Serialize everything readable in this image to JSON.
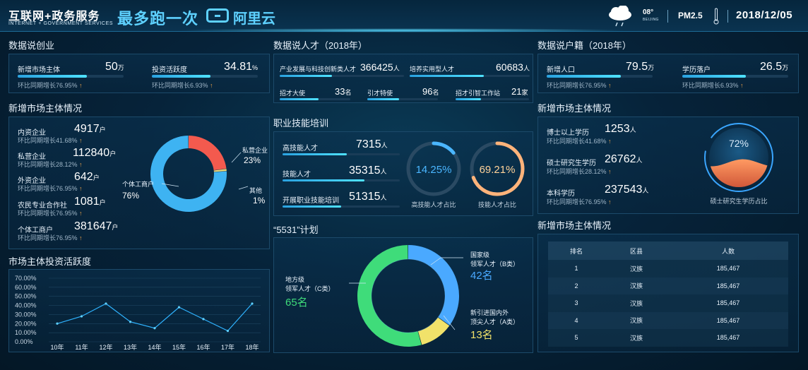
{
  "header": {
    "brand_cn": "互联网+政务服务",
    "brand_en": "INTERNET + GOVERNMENT SERVICES",
    "slogan": "最多跑一次",
    "slogan_brand": "阿里云",
    "temperature": "08°",
    "city": "BEIJING",
    "pm": "PM2.5",
    "date": "2018/12/05"
  },
  "startup": {
    "title": "数据说创业",
    "items": [
      {
        "label": "新增市场主体",
        "value": "50",
        "unit": "万",
        "growth": "环比同期增长76.95%",
        "progress": 0.65
      },
      {
        "label": "投资活跃度",
        "value": "34.81",
        "unit": "%",
        "growth": "环比同期增长6.93%",
        "progress": 0.55
      }
    ]
  },
  "market_left": {
    "title": "新增市场主体情况",
    "items": [
      {
        "label": "内资企业",
        "value": "4917",
        "unit": "户",
        "growth": "环比同期增长41.68%"
      },
      {
        "label": "私营企业",
        "value": "112840",
        "unit": "户",
        "growth": "环比同期增长28.12%"
      },
      {
        "label": "外资企业",
        "value": "642",
        "unit": "户",
        "growth": "环比同期增长76.95%"
      },
      {
        "label": "农民专业合作社",
        "value": "1081",
        "unit": "户",
        "growth": "环比同期增长76.95%"
      },
      {
        "label": "个体工商户",
        "value": "381647",
        "unit": "户",
        "growth": "环比同期增长76.95%"
      }
    ],
    "donut": [
      {
        "name": "私营企业",
        "pct": "23%",
        "value": 23,
        "color": "#f35a4e"
      },
      {
        "name": "其他",
        "pct": "1%",
        "value": 1,
        "color": "#e9d77a"
      },
      {
        "name": "个体工商户",
        "pct": "76%",
        "value": 76,
        "color": "#3eb3f2"
      }
    ]
  },
  "activity": {
    "title": "市场主体投资活跃度",
    "chart_data": {
      "type": "line",
      "x": [
        "10年",
        "11年",
        "12年",
        "13年",
        "14年",
        "15年",
        "16年",
        "17年",
        "18年"
      ],
      "values": [
        20,
        28,
        42,
        22,
        15,
        38,
        25,
        12,
        42
      ],
      "yticks": [
        "70.00%",
        "60.00%",
        "50.00%",
        "40.00%",
        "30.00%",
        "20.00%",
        "10.00%",
        "0.00%"
      ],
      "ylim": [
        0,
        70
      ]
    }
  },
  "talent": {
    "title": "数据说人才（2018年）",
    "row1": [
      {
        "label": "产业发展与科技创新类人才",
        "value": "366425",
        "unit": "人",
        "progress": 0.42
      },
      {
        "label": "培养实用型人才",
        "value": "60683",
        "unit": "人",
        "progress": 0.62
      }
    ],
    "row2": [
      {
        "label": "招才大使",
        "value": "33",
        "unit": "名",
        "progress": 0.55
      },
      {
        "label": "引才特使",
        "value": "96",
        "unit": "名",
        "progress": 0.45
      },
      {
        "label": "招才引智工作站",
        "value": "21",
        "unit": "家",
        "progress": 0.35
      }
    ]
  },
  "skills": {
    "title": "职业技能培训",
    "items": [
      {
        "label": "高技能人才",
        "value": "7315",
        "unit": "人",
        "progress": 0.55
      },
      {
        "label": "技能人才",
        "value": "35315",
        "unit": "人",
        "progress": 0.7
      },
      {
        "label": "开展职业技能培训",
        "value": "51315",
        "unit": "人",
        "progress": 0.5
      }
    ],
    "gauges": [
      {
        "value": "14.25%",
        "label": "高技能人才占比",
        "fraction": 0.1425,
        "color": "#4ab6ff"
      },
      {
        "value": "69.21%",
        "label": "技能人才占比",
        "fraction": 0.6921,
        "color": "#ffb37a"
      }
    ]
  },
  "plan": {
    "title": "“5531”计划",
    "segments": [
      {
        "line1": "国家级",
        "line2": "领军人才（B类）",
        "count": "42名",
        "value": 42,
        "color": "#4aa9ff"
      },
      {
        "line1": "新引进国内外",
        "line2": "顶尖人才（A类）",
        "count": "13名",
        "value": 13,
        "color": "#f1e26a"
      },
      {
        "line1": "地方级",
        "line2": "领军人才（C类）",
        "count": "65名",
        "value": 65,
        "color": "#3fdc7a"
      }
    ]
  },
  "household": {
    "title": "数据说户籍（2018年）",
    "items": [
      {
        "label": "新增人口",
        "value": "79.5",
        "unit": "万",
        "growth": "环比同期增长76.95%",
        "progress": 0.7
      },
      {
        "label": "学历落户",
        "value": "26.5",
        "unit": "万",
        "growth": "环比同期增长6.93%",
        "progress": 0.6
      }
    ]
  },
  "market_right": {
    "title": "新增市场主体情况",
    "items": [
      {
        "label": "博士以上学历",
        "value": "1253",
        "unit": "人",
        "growth": "环比同期增长41.68%"
      },
      {
        "label": "硕士研究生学历",
        "value": "26762",
        "unit": "人",
        "growth": "环比同期增长28.12%"
      },
      {
        "label": "本科学历",
        "value": "237543",
        "unit": "人",
        "growth": "环比同期增长76.95%"
      }
    ],
    "ball": {
      "value": "72%",
      "label": "硕士研究生学历占比",
      "fraction": 0.72
    }
  },
  "ranking": {
    "title": "新增市场主体情况",
    "headers": [
      "排名",
      "区县",
      "人数"
    ],
    "rows": [
      [
        "1",
        "汉族",
        "185,467"
      ],
      [
        "2",
        "汉族",
        "185,467"
      ],
      [
        "3",
        "汉族",
        "185,467"
      ],
      [
        "4",
        "汉族",
        "185,467"
      ],
      [
        "5",
        "汉族",
        "185,467"
      ]
    ]
  },
  "colors": {
    "accent": "#4fe2ff",
    "orange": "#f0a54a",
    "text": "#e8f2fb"
  }
}
